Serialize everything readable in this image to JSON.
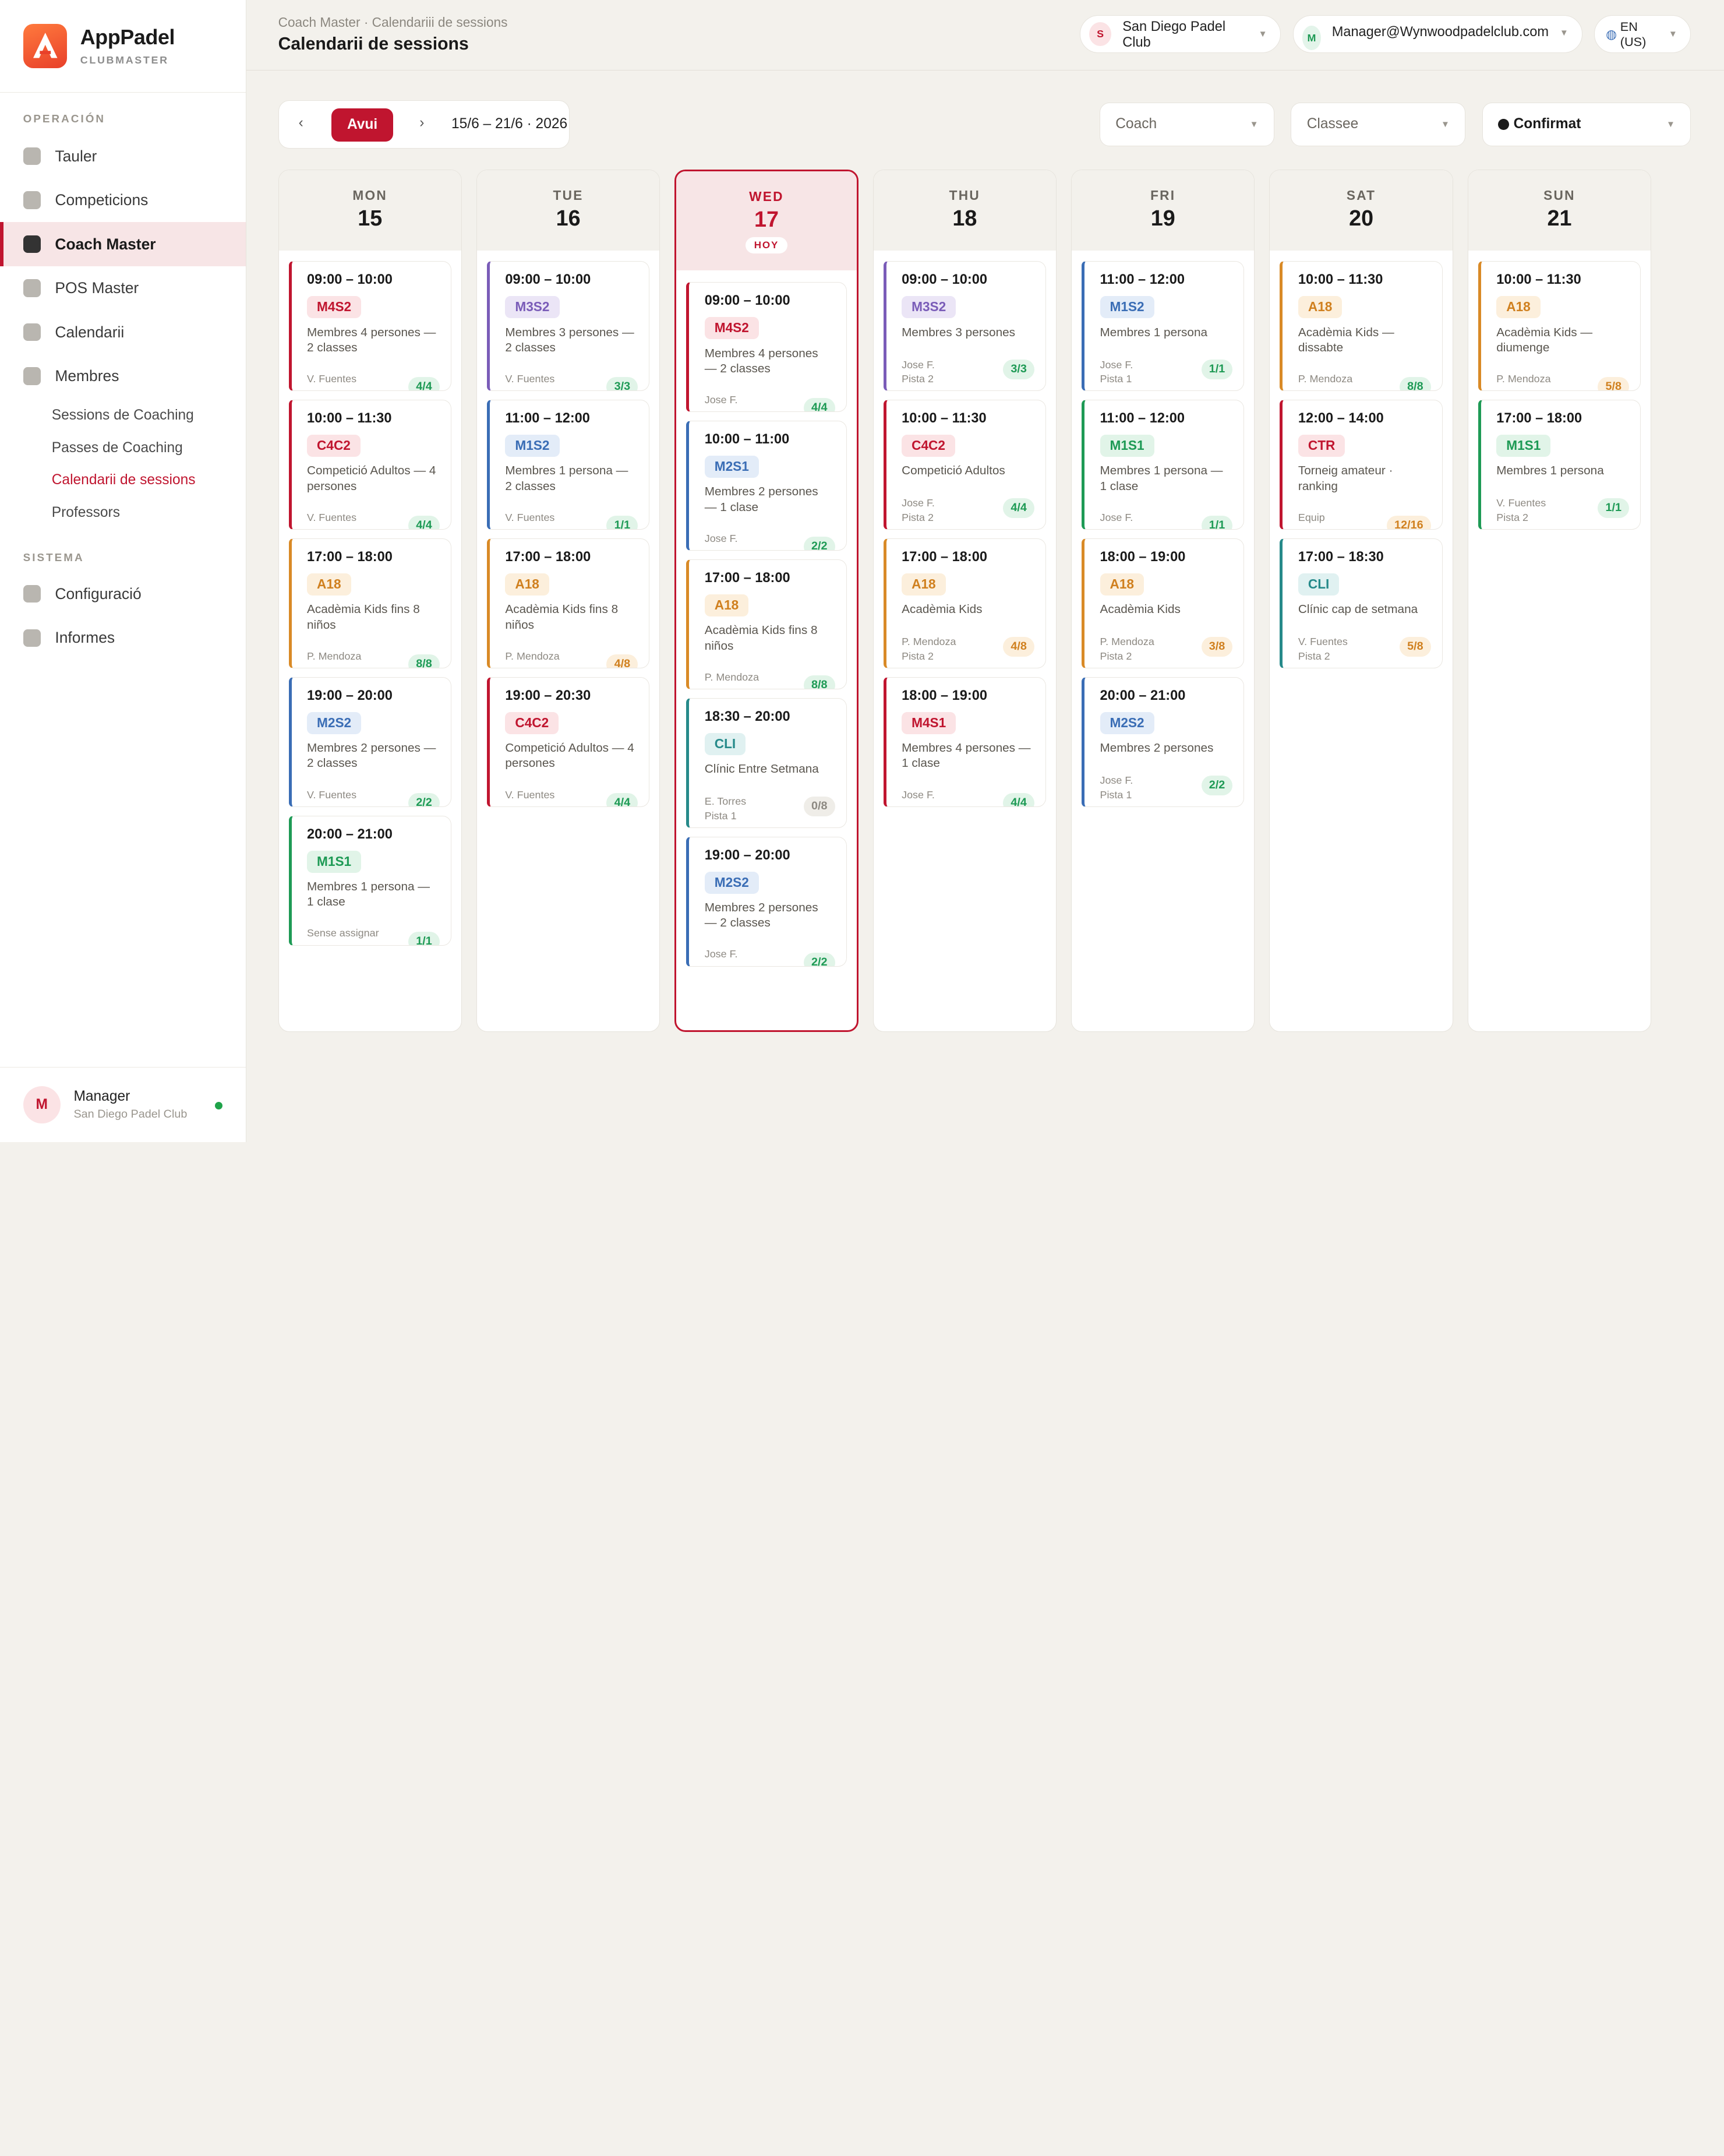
{
  "brand": {
    "name": "AppPadel",
    "sub": "CLUBMASTER"
  },
  "sidebar": {
    "section1": "OPERACIÓN",
    "items1": [
      {
        "label": "Tauler"
      },
      {
        "label": "Competicions"
      },
      {
        "label": "Coach Master",
        "active": true
      },
      {
        "label": "POS Master"
      },
      {
        "label": "Calendarii"
      },
      {
        "label": "Membres"
      }
    ],
    "subitems": [
      {
        "label": "Sessions de Coaching"
      },
      {
        "label": "Passes de Coaching"
      },
      {
        "label": "Calendarii de sessions",
        "active": true
      },
      {
        "label": "Professors"
      }
    ],
    "section2": "SISTEMA",
    "items2": [
      {
        "label": "Configuració"
      },
      {
        "label": "Informes"
      }
    ],
    "user": {
      "initial": "M",
      "name": "Manager",
      "club": "San Diego Padel Club"
    }
  },
  "header": {
    "breadcrumb": "Coach Master · Calendariii de sessions",
    "title": "Calendarii de sessions",
    "club": {
      "initial": "S",
      "label": "San Diego Padel Club"
    },
    "account": {
      "initial": "M",
      "label": "Manager@Wynwoodpadelclub.com"
    },
    "lang": "EN (US)"
  },
  "toolbar": {
    "prev": "‹",
    "next": "›",
    "today": "Avui",
    "range": "15/6 – 21/6 · 2026",
    "filters": {
      "coach": "Coach",
      "classe": "Classee",
      "status": "Confirmat"
    }
  },
  "colors": {
    "accent": "#c0152f",
    "green": "#1e9a55",
    "orange": "#d98a26",
    "blue": "#3a6db5",
    "purple": "#7a5cb8",
    "teal": "#268a8a",
    "red": "#c0152f"
  },
  "days": [
    {
      "name": "MON",
      "num": "15",
      "sessions": [
        {
          "time": "09:00 – 10:00",
          "tag": "M4S2",
          "color": "red",
          "desc": "Membres 4 persones — 2 classes",
          "meta": "V. Fuentes",
          "cap": "4/4",
          "capc": "green"
        },
        {
          "time": "10:00 – 11:30",
          "tag": "C4C2",
          "color": "red",
          "desc": "Competició Adultos — 4 persones",
          "meta": "V. Fuentes",
          "cap": "4/4",
          "capc": "green"
        },
        {
          "time": "17:00 – 18:00",
          "tag": "A18",
          "color": "orange",
          "desc": "Acadèmia Kids fins 8 niños",
          "meta": "P. Mendoza",
          "cap": "8/8",
          "capc": "green"
        },
        {
          "time": "19:00 – 20:00",
          "tag": "M2S2",
          "color": "blue",
          "desc": "Membres 2 persones — 2 classes",
          "meta": "V. Fuentes",
          "cap": "2/2",
          "capc": "green"
        },
        {
          "time": "20:00 – 21:00",
          "tag": "M1S1",
          "color": "green",
          "desc": "Membres 1 persona — 1 clase",
          "meta": "Sense assignar",
          "cap": "1/1",
          "capc": "green"
        }
      ]
    },
    {
      "name": "TUE",
      "num": "16",
      "sessions": [
        {
          "time": "09:00 – 10:00",
          "tag": "M3S2",
          "color": "purple",
          "desc": "Membres 3 persones — 2 classes",
          "meta": "V. Fuentes",
          "cap": "3/3",
          "capc": "green"
        },
        {
          "time": "11:00 – 12:00",
          "tag": "M1S2",
          "color": "blue",
          "desc": "Membres 1 persona — 2 classes",
          "meta": "V. Fuentes",
          "cap": "1/1",
          "capc": "green"
        },
        {
          "time": "17:00 – 18:00",
          "tag": "A18",
          "color": "orange",
          "desc": "Acadèmia Kids fins 8 niños",
          "meta": "P. Mendoza",
          "cap": "4/8",
          "capc": "orange"
        },
        {
          "time": "19:00 – 20:30",
          "tag": "C4C2",
          "color": "red",
          "desc": "Competició Adultos — 4 persones",
          "meta": "V. Fuentes",
          "cap": "4/4",
          "capc": "green"
        }
      ]
    },
    {
      "name": "WED",
      "num": "17",
      "today": true,
      "hoy": "HOY",
      "sessions": [
        {
          "time": "09:00 – 10:00",
          "tag": "M4S2",
          "color": "red",
          "desc": "Membres 4 persones — 2 classes",
          "meta": "Jose F.",
          "cap": "4/4",
          "capc": "green"
        },
        {
          "time": "10:00 – 11:00",
          "tag": "M2S1",
          "color": "blue",
          "desc": "Membres 2 persones — 1 clase",
          "meta": "Jose F.",
          "cap": "2/2",
          "capc": "green"
        },
        {
          "time": "17:00 – 18:00",
          "tag": "A18",
          "color": "orange",
          "desc": "Acadèmia Kids fins 8 niños",
          "meta": "P. Mendoza",
          "cap": "8/8",
          "capc": "green"
        },
        {
          "time": "18:30 – 20:00",
          "tag": "CLI",
          "color": "teal",
          "desc": "Clínic Entre Setmana",
          "meta": "E. Torres",
          "meta2": "Pista 1",
          "cap": "0/8",
          "capc": "grey"
        },
        {
          "time": "19:00 – 20:00",
          "tag": "M2S2",
          "color": "blue",
          "desc": "Membres 2 persones — 2 classes",
          "meta": "Jose F.",
          "cap": "2/2",
          "capc": "green"
        }
      ]
    },
    {
      "name": "THU",
      "num": "18",
      "sessions": [
        {
          "time": "09:00 – 10:00",
          "tag": "M3S2",
          "color": "purple",
          "desc": "Membres 3 persones",
          "meta": "Jose F.",
          "meta2": "Pista 2",
          "cap": "3/3",
          "capc": "green"
        },
        {
          "time": "10:00 – 11:30",
          "tag": "C4C2",
          "color": "red",
          "desc": "Competició Adultos",
          "meta": "Jose F.",
          "meta2": "Pista 2",
          "cap": "4/4",
          "capc": "green"
        },
        {
          "time": "17:00 – 18:00",
          "tag": "A18",
          "color": "orange",
          "desc": "Acadèmia Kids",
          "meta": "P. Mendoza",
          "meta2": "Pista 2",
          "cap": "4/8",
          "capc": "orange"
        },
        {
          "time": "18:00 – 19:00",
          "tag": "M4S1",
          "color": "red",
          "desc": "Membres 4 persones — 1 clase",
          "meta": "Jose F.",
          "cap": "4/4",
          "capc": "green"
        }
      ]
    },
    {
      "name": "FRI",
      "num": "19",
      "sessions": [
        {
          "time": "11:00 – 12:00",
          "tag": "M1S2",
          "color": "blue",
          "desc": "Membres 1 persona",
          "meta": "Jose F.",
          "meta2": "Pista 1",
          "cap": "1/1",
          "capc": "green"
        },
        {
          "time": "11:00 – 12:00",
          "tag": "M1S1",
          "color": "green",
          "desc": "Membres 1 persona — 1 clase",
          "meta": "Jose F.",
          "cap": "1/1",
          "capc": "green"
        },
        {
          "time": "18:00 – 19:00",
          "tag": "A18",
          "color": "orange",
          "desc": "Acadèmia Kids",
          "meta": "P. Mendoza",
          "meta2": "Pista 2",
          "cap": "3/8",
          "capc": "orange"
        },
        {
          "time": "20:00 – 21:00",
          "tag": "M2S2",
          "color": "blue",
          "desc": "Membres 2 persones",
          "meta": "Jose F.",
          "meta2": "Pista 1",
          "cap": "2/2",
          "capc": "green"
        }
      ]
    },
    {
      "name": "SAT",
      "num": "20",
      "sessions": [
        {
          "time": "10:00 – 11:30",
          "tag": "A18",
          "color": "orange",
          "desc": "Acadèmia Kids — dissabte",
          "meta": "P. Mendoza",
          "cap": "8/8",
          "capc": "green"
        },
        {
          "time": "12:00 – 14:00",
          "tag": "CTR",
          "color": "red",
          "desc": "Torneig amateur · ranking",
          "meta": "Equip",
          "cap": "12/16",
          "capc": "orange"
        },
        {
          "time": "17:00 – 18:30",
          "tag": "CLI",
          "color": "teal",
          "desc": "Clínic cap de setmana",
          "meta": "V. Fuentes",
          "meta2": "Pista 2",
          "cap": "5/8",
          "capc": "orange"
        }
      ]
    },
    {
      "name": "SUN",
      "num": "21",
      "sessions": [
        {
          "time": "10:00 – 11:30",
          "tag": "A18",
          "color": "orange",
          "desc": "Acadèmia Kids — diumenge",
          "meta": "P. Mendoza",
          "cap": "5/8",
          "capc": "orange"
        },
        {
          "time": "17:00 – 18:00",
          "tag": "M1S1",
          "color": "green",
          "desc": "Membres 1 persona",
          "meta": "V. Fuentes",
          "meta2": "Pista 2",
          "cap": "1/1",
          "capc": "green"
        }
      ]
    }
  ]
}
